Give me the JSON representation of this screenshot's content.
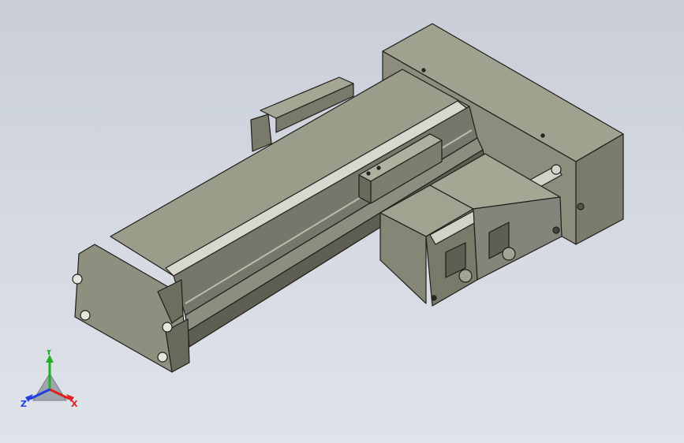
{
  "triad": {
    "x_label": "X",
    "y_label": "Y",
    "z_label": "Z",
    "colors": {
      "x": "#e02020",
      "y": "#20b020",
      "z": "#2040e0"
    }
  },
  "model": {
    "body_color": "#8a8a78",
    "light_face_color": "#a6a695",
    "dark_face_color": "#6e6e5f",
    "rail_color": "#d8d8d0",
    "edge_color": "#1e1e1a"
  }
}
